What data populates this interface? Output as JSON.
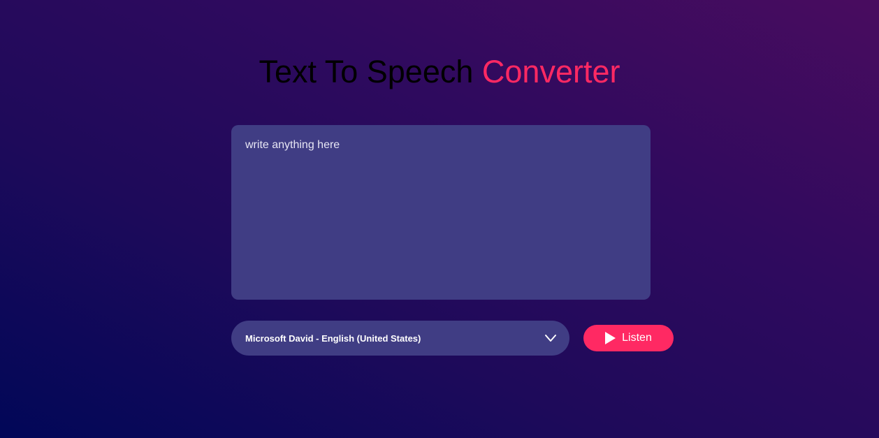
{
  "header": {
    "title_main": "Text To Speech ",
    "title_accent": "Converter"
  },
  "editor": {
    "placeholder": "write anything here",
    "value": ""
  },
  "voice_select": {
    "selected": "Microsoft David - English (United States)",
    "icon": "chevron-down-icon"
  },
  "listen_button": {
    "label": "Listen",
    "icon": "play-icon"
  },
  "colors": {
    "accent": "#ff2963",
    "panel": "#403d84",
    "text": "#ffffff"
  }
}
